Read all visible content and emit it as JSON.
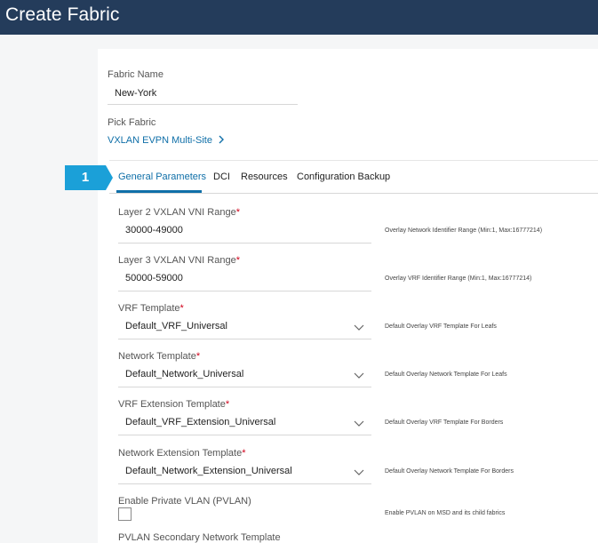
{
  "header": {
    "title": "Create Fabric"
  },
  "fabric_name": {
    "label": "Fabric Name",
    "value": "New-York"
  },
  "pick_fabric": {
    "label": "Pick Fabric",
    "link": "VXLAN EVPN Multi-Site"
  },
  "step": {
    "number": "1"
  },
  "tabs": [
    {
      "label": "General Parameters",
      "active": true
    },
    {
      "label": "DCI"
    },
    {
      "label": "Resources"
    },
    {
      "label": "Configuration Backup"
    }
  ],
  "fields": [
    {
      "label": "Layer 2 VXLAN VNI Range",
      "value": "30000-49000",
      "help": "Overlay Network Identifier Range (Min:1, Max:16777214)"
    },
    {
      "label": "Layer 3 VXLAN VNI Range",
      "value": "50000-59000",
      "help": "Overlay VRF Identifier Range (Min:1, Max:16777214)"
    },
    {
      "label": "VRF Template",
      "value": "Default_VRF_Universal",
      "help": "Default Overlay VRF Template For Leafs"
    },
    {
      "label": "Network Template",
      "value": "Default_Network_Universal",
      "help": "Default Overlay Network Template For Leafs"
    },
    {
      "label": "VRF Extension Template",
      "value": "Default_VRF_Extension_Universal",
      "help": "Default Overlay VRF Template For Borders"
    },
    {
      "label": "Network Extension Template",
      "value": "Default_Network_Extension_Universal",
      "help": "Default Overlay Network Template For Borders"
    }
  ],
  "required_mark": "*",
  "pvlan": {
    "label": "Enable Private VLAN (PVLAN)",
    "help": "Enable PVLAN on MSD and its child fabrics"
  },
  "pvlan_secondary": {
    "label": "PVLAN Secondary Network Template"
  },
  "colors": {
    "header": "#243c5b",
    "accent": "#0f6fa8",
    "step_badge": "#1ba0d8",
    "required": "#d0021b"
  }
}
